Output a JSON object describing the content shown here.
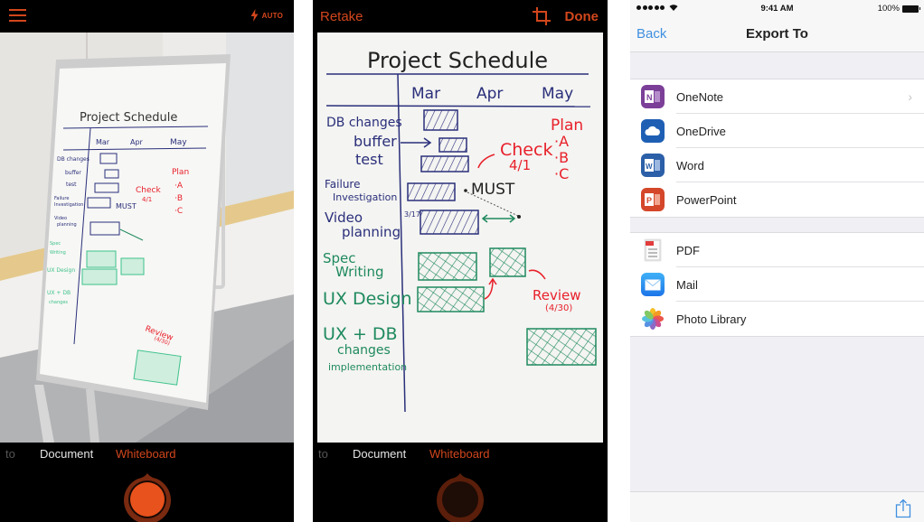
{
  "colors": {
    "accent_orange": "#d2461c",
    "ios_blue": "#3f8fe0",
    "marker_blue": "#2a2f7a",
    "marker_green": "#1f8a5e",
    "marker_red": "#e8202a"
  },
  "camera_screen": {
    "menu_icon": "hamburger-icon",
    "flash_icon": "lightning-icon",
    "flash_label": "AUTO",
    "modes": {
      "partial": "to",
      "document": "Document",
      "whiteboard": "Whiteboard"
    },
    "active_mode": "Whiteboard",
    "shutter_icon": "shutter-button"
  },
  "preview_screen": {
    "retake_label": "Retake",
    "crop_icon": "crop-icon",
    "done_label": "Done",
    "modes": {
      "partial": "to",
      "document": "Document",
      "whiteboard": "Whiteboard"
    },
    "whiteboard": {
      "title": "Project Schedule",
      "months": [
        "Mar",
        "Apr",
        "May"
      ],
      "tasks": [
        {
          "label": "DB changes",
          "color": "blue"
        },
        {
          "label": "buffer",
          "color": "blue"
        },
        {
          "label": "test",
          "color": "blue"
        },
        {
          "label": "Failure",
          "label2": "Investigation",
          "color": "blue"
        },
        {
          "label": "Video",
          "label2": "planning",
          "color": "blue"
        },
        {
          "label": "Spec",
          "label2": "Writing",
          "color": "green"
        },
        {
          "label": "UX Design",
          "color": "green"
        },
        {
          "label": "UX + DB",
          "label2": "changes",
          "label3": "implementation",
          "color": "green"
        }
      ],
      "notes": {
        "plan": "Plan",
        "plan_a": "·A",
        "plan_b": "·B",
        "plan_c": "·C",
        "check": "Check",
        "check_date": "4/1",
        "must": "MUST",
        "date_317": "3/17",
        "review": "Review",
        "review_date": "(4/30)"
      }
    }
  },
  "export_screen": {
    "status_bar": {
      "signal_dots": 5,
      "time": "9:41 AM",
      "battery": "100%"
    },
    "nav": {
      "back_label": "Back",
      "title": "Export To"
    },
    "groups": [
      {
        "items": [
          {
            "label": "OneNote",
            "icon": "onenote-icon",
            "color": "#7b3f98",
            "glyph": "N",
            "has_chevron": true
          },
          {
            "label": "OneDrive",
            "icon": "onedrive-icon",
            "color": "#1e5fb4",
            "glyph": "",
            "has_chevron": false
          },
          {
            "label": "Word",
            "icon": "word-icon",
            "color": "#2b5fa8",
            "glyph": "W",
            "has_chevron": false
          },
          {
            "label": "PowerPoint",
            "icon": "powerpoint-icon",
            "color": "#d4472a",
            "glyph": "P",
            "has_chevron": false
          }
        ]
      },
      {
        "items": [
          {
            "label": "PDF",
            "icon": "pdf-icon",
            "color": "#e8e8ea",
            "glyph": "PDF",
            "has_chevron": false
          },
          {
            "label": "Mail",
            "icon": "mail-icon",
            "color": "#2a8ef0",
            "glyph": "",
            "has_chevron": false
          },
          {
            "label": "Photo Library",
            "icon": "photos-icon",
            "color": "#ffffff",
            "glyph": "",
            "has_chevron": false
          }
        ]
      }
    ],
    "chevron_glyph": "›",
    "toolbar": {
      "share_icon": "share-icon"
    }
  }
}
